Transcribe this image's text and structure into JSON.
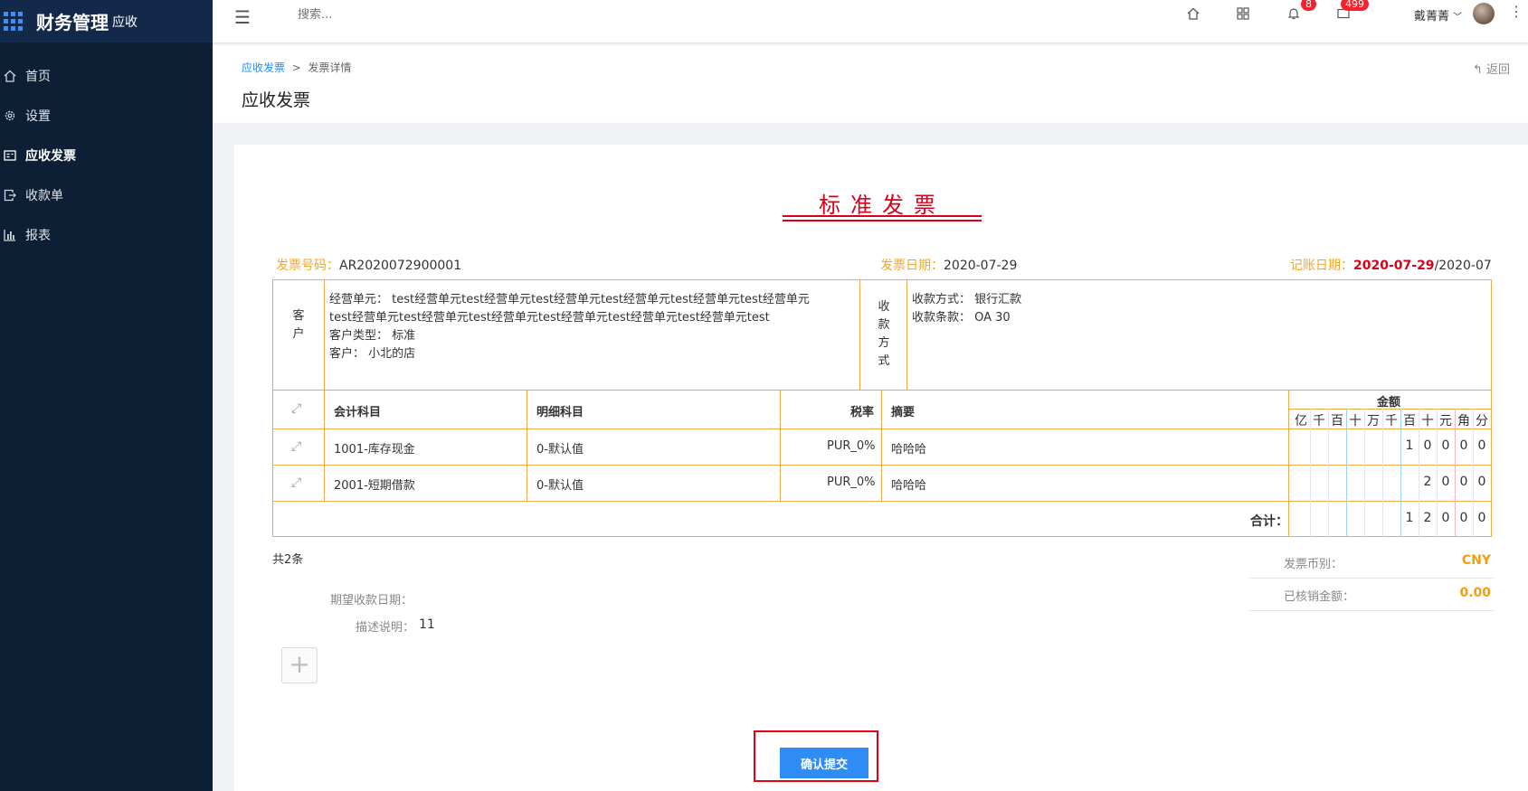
{
  "app": {
    "title": "财务管理",
    "subtitle": "应收"
  },
  "sidebar": {
    "items": [
      {
        "label": "首页",
        "icon": "home-icon",
        "active": false
      },
      {
        "label": "设置",
        "icon": "gear-icon",
        "active": false
      },
      {
        "label": "应收发票",
        "icon": "invoice-icon",
        "active": true
      },
      {
        "label": "收款单",
        "icon": "receipt-icon",
        "active": false
      },
      {
        "label": "报表",
        "icon": "bar-chart-icon",
        "active": false
      }
    ]
  },
  "topbar": {
    "search_placeholder": "搜索...",
    "notification_count": "8",
    "message_count": "499",
    "username": "戴菁菁"
  },
  "breadcrumb": {
    "parent": "应收发票",
    "separator": ">",
    "current": "发票详情"
  },
  "page": {
    "title": "应收发票",
    "back_label": "返回"
  },
  "invoice": {
    "title": "标准发票",
    "number_label": "发票号码：",
    "number": "AR2020072900001",
    "date_label": "发票日期：",
    "date": "2020-07-29",
    "post_date_label": "记账日期：",
    "post_date_bold": "2020-07-29",
    "post_date_rest": "/2020-07",
    "customer_header": "客户",
    "customer_lines": [
      "经营单元： test经营单元test经营单元test经营单元test经营单元test经营单元test经营单元",
      "test经营单元test经营单元test经营单元test经营单元test经营单元test经营单元test",
      "客户类型： 标准",
      "客户： 小北的店"
    ],
    "payment_header": "收款方式",
    "payment_lines": [
      "收款方式： 银行汇款",
      "收款条款： OA 30"
    ],
    "columns": {
      "account": "会计科目",
      "detail": "明细科目",
      "tax": "税率",
      "summary": "摘要",
      "amount": "金额"
    },
    "digit_units": [
      "亿",
      "千",
      "百",
      "十",
      "万",
      "千",
      "百",
      "十",
      "元",
      "角",
      "分"
    ],
    "rows": [
      {
        "account": "1001-库存现金",
        "detail": "0-默认值",
        "tax": "PUR_0%",
        "summary": "哈哈哈",
        "digits": [
          "",
          "",
          "",
          "",
          "",
          "",
          "1",
          "0",
          "0",
          "0",
          "0"
        ]
      },
      {
        "account": "2001-短期借款",
        "detail": "0-默认值",
        "tax": "PUR_0%",
        "summary": "哈哈哈",
        "digits": [
          "",
          "",
          "",
          "",
          "",
          "",
          "",
          "2",
          "0",
          "0",
          "0"
        ]
      }
    ],
    "total_label": "合计：",
    "total_digits": [
      "",
      "",
      "",
      "",
      "",
      "",
      "1",
      "2",
      "0",
      "0",
      "0"
    ],
    "row_count": "共2条",
    "currency_label": "发票币别：",
    "currency": "CNY",
    "verified_label": "已核销金额：",
    "verified_amount": "0.00",
    "expected_date_label": "期望收款日期：",
    "expected_date": "",
    "description_label": "描述说明：",
    "description": "11"
  },
  "actions": {
    "submit_label": "确认提交"
  }
}
